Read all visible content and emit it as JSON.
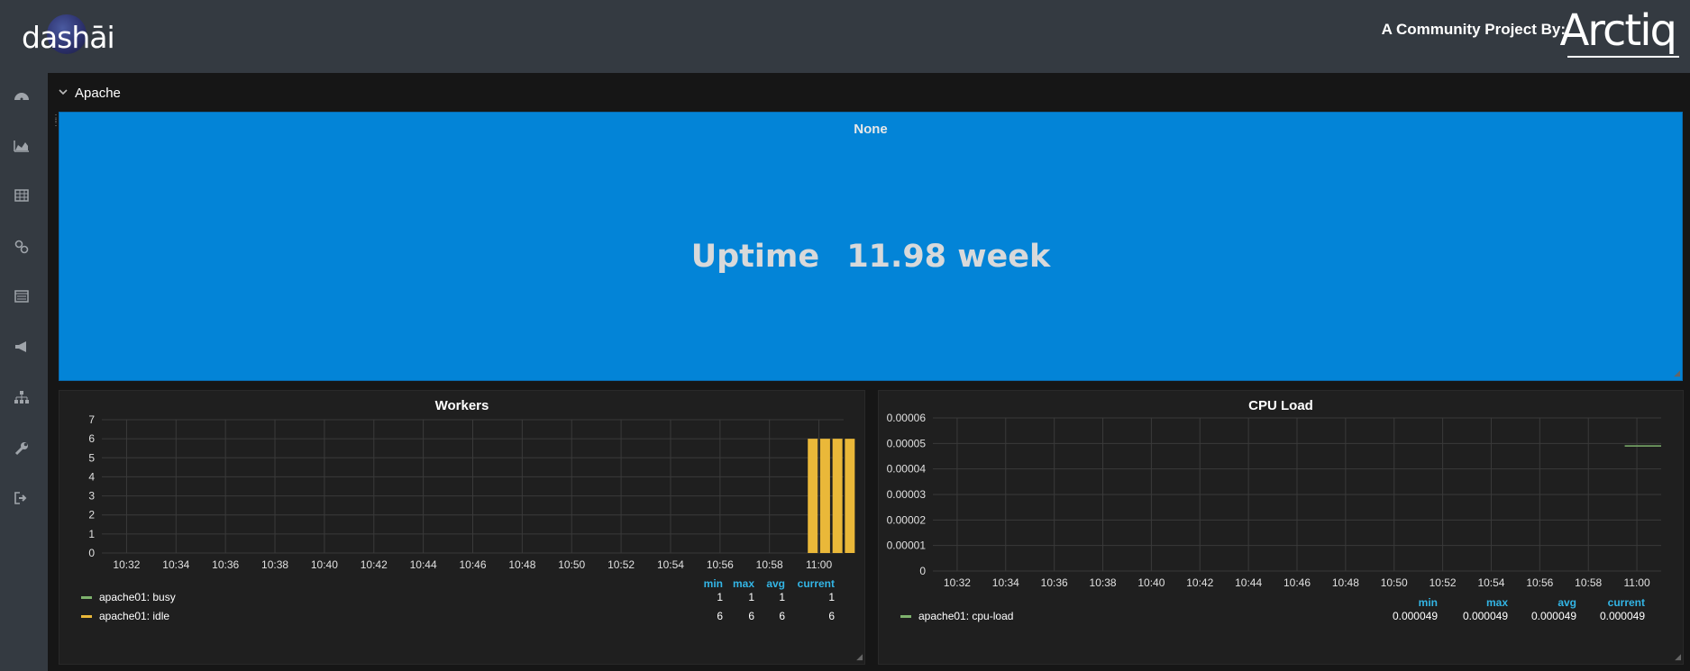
{
  "brand": {
    "logo_text": "dashāi",
    "community_label": "A Community Project By:",
    "partner_logo": "Arctiq"
  },
  "sidebar": {
    "icons": [
      "dashboard-icon",
      "chart-area-icon",
      "table-icon",
      "link-icon",
      "panel-icon",
      "megaphone-icon",
      "sitemap-icon",
      "wrench-icon",
      "sign-out-icon"
    ]
  },
  "row": {
    "title": "Apache",
    "collapse_icon": "chevron-down-icon"
  },
  "uptime_panel": {
    "title": "None",
    "prefix": "Uptime",
    "value": "11.98 week",
    "color": "#0384d7"
  },
  "workers_panel": {
    "title": "Workers",
    "legend_headers": [
      "min",
      "max",
      "avg",
      "current"
    ],
    "legend": [
      {
        "name": "apache01: busy",
        "color": "#7eb26d",
        "min": "1",
        "max": "1",
        "avg": "1",
        "current": "1"
      },
      {
        "name": "apache01: idle",
        "color": "#eab839",
        "min": "6",
        "max": "6",
        "avg": "6",
        "current": "6"
      }
    ]
  },
  "cpu_panel": {
    "title": "CPU Load",
    "legend_headers": [
      "min",
      "max",
      "avg",
      "current"
    ],
    "legend": [
      {
        "name": "apache01: cpu-load",
        "color": "#7eb26d",
        "min": "0.000049",
        "max": "0.000049",
        "avg": "0.000049",
        "current": "0.000049"
      }
    ]
  },
  "chart_data": [
    {
      "type": "bar",
      "title": "Workers",
      "x": [
        "10:32",
        "10:34",
        "10:36",
        "10:38",
        "10:40",
        "10:42",
        "10:44",
        "10:46",
        "10:48",
        "10:50",
        "10:52",
        "10:54",
        "10:56",
        "10:58",
        "11:00"
      ],
      "xlim": [
        "10:31",
        "11:01"
      ],
      "ylim": [
        0,
        7
      ],
      "yticks": [
        0,
        1,
        2,
        3,
        4,
        5,
        6,
        7
      ],
      "grid": true,
      "series": [
        {
          "name": "apache01: idle",
          "color": "#eab839",
          "points": [
            [
              "10:59:45",
              6
            ],
            [
              "11:00:15",
              6
            ],
            [
              "11:00:45",
              6
            ],
            [
              "11:01:15",
              6
            ]
          ]
        },
        {
          "name": "apache01: busy",
          "color": "#7eb26d",
          "points": []
        }
      ]
    },
    {
      "type": "line",
      "title": "CPU Load",
      "x": [
        "10:32",
        "10:34",
        "10:36",
        "10:38",
        "10:40",
        "10:42",
        "10:44",
        "10:46",
        "10:48",
        "10:50",
        "10:52",
        "10:54",
        "10:56",
        "10:58",
        "11:00"
      ],
      "xlim": [
        "10:31",
        "11:01"
      ],
      "ylim": [
        0,
        6e-05
      ],
      "yticks": [
        "0",
        "0.00001",
        "0.00002",
        "0.00003",
        "0.00004",
        "0.00005",
        "0.00006"
      ],
      "grid": true,
      "series": [
        {
          "name": "apache01: cpu-load",
          "color": "#7eb26d",
          "points": [
            [
              "10:59:30",
              4.9e-05
            ],
            [
              "11:01",
              4.9e-05
            ]
          ]
        }
      ]
    }
  ]
}
